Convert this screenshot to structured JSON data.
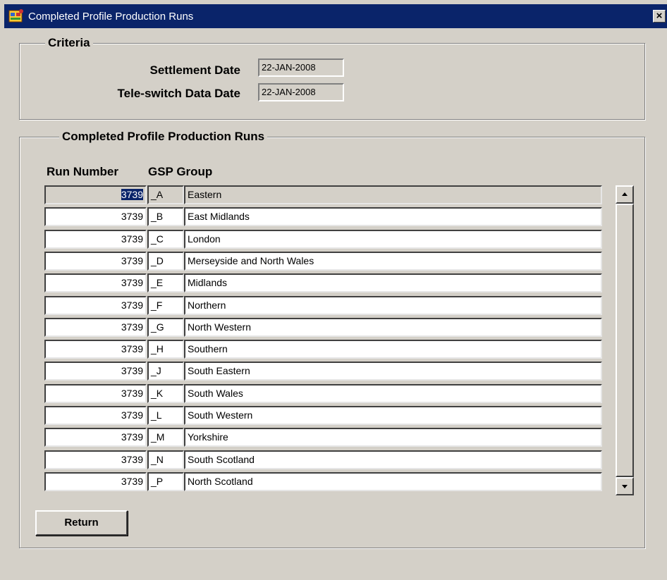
{
  "window": {
    "title": "Completed Profile Production Runs",
    "close_label": "×"
  },
  "criteria": {
    "legend": "Criteria",
    "settlement_date_label": "Settlement Date",
    "settlement_date_value": "22-JAN-2008",
    "teleswitch_date_label": "Tele-switch Data Date",
    "teleswitch_date_value": "22-JAN-2008"
  },
  "runs": {
    "legend": "Completed Profile Production Runs",
    "col_run_number": "Run Number",
    "col_gsp_group": "GSP Group",
    "rows": [
      {
        "run": "3739",
        "code": "_A",
        "name": "Eastern"
      },
      {
        "run": "3739",
        "code": "_B",
        "name": "East Midlands"
      },
      {
        "run": "3739",
        "code": "_C",
        "name": "London"
      },
      {
        "run": "3739",
        "code": "_D",
        "name": "Merseyside and North Wales"
      },
      {
        "run": "3739",
        "code": "_E",
        "name": "Midlands"
      },
      {
        "run": "3739",
        "code": "_F",
        "name": "Northern"
      },
      {
        "run": "3739",
        "code": "_G",
        "name": "North Western"
      },
      {
        "run": "3739",
        "code": "_H",
        "name": "Southern"
      },
      {
        "run": "3739",
        "code": "_J",
        "name": "South Eastern"
      },
      {
        "run": "3739",
        "code": "_K",
        "name": "South Wales"
      },
      {
        "run": "3739",
        "code": "_L",
        "name": "South Western"
      },
      {
        "run": "3739",
        "code": "_M",
        "name": "Yorkshire"
      },
      {
        "run": "3739",
        "code": "_N",
        "name": "South Scotland"
      },
      {
        "run": "3739",
        "code": "_P",
        "name": "North Scotland"
      }
    ]
  },
  "actions": {
    "return_label": "Return"
  },
  "icons": {
    "app": "oracle-forms-icon",
    "scroll_up": "arrow-up-icon",
    "scroll_down": "arrow-down-icon"
  }
}
